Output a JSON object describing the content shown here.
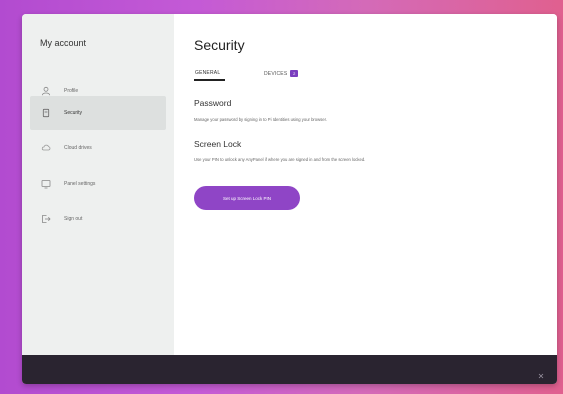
{
  "sidebar": {
    "title": "My account",
    "items": [
      {
        "label": "Profile",
        "icon": "user-icon",
        "active": false
      },
      {
        "label": "Security",
        "icon": "shield-icon",
        "active": true
      },
      {
        "label": "Cloud drives",
        "icon": "cloud-icon",
        "active": false
      },
      {
        "label": "Panel settings",
        "icon": "panel-settings-icon",
        "active": false
      },
      {
        "label": "Sign out",
        "icon": "sign-out-icon",
        "active": false
      }
    ]
  },
  "main": {
    "title": "Security",
    "tabs": [
      {
        "label": "GENERAL",
        "active": true
      },
      {
        "label": "DEVICES",
        "badge": "2",
        "active": false
      }
    ],
    "password": {
      "title": "Password",
      "description": "Manage your password by signing in to Pi Identities using your browser."
    },
    "screen_lock": {
      "title": "Screen Lock",
      "description": "Use your PIN to unlock any AnyPanel if where you are signed in and from the screen locked.",
      "button_label": "Set up Screen Lock PIN"
    }
  },
  "colors": {
    "accent": "#8f45c6",
    "badge": "#7b3fbf",
    "sidebar_bg": "#eef0ef",
    "footer_bg": "#2a2430"
  }
}
